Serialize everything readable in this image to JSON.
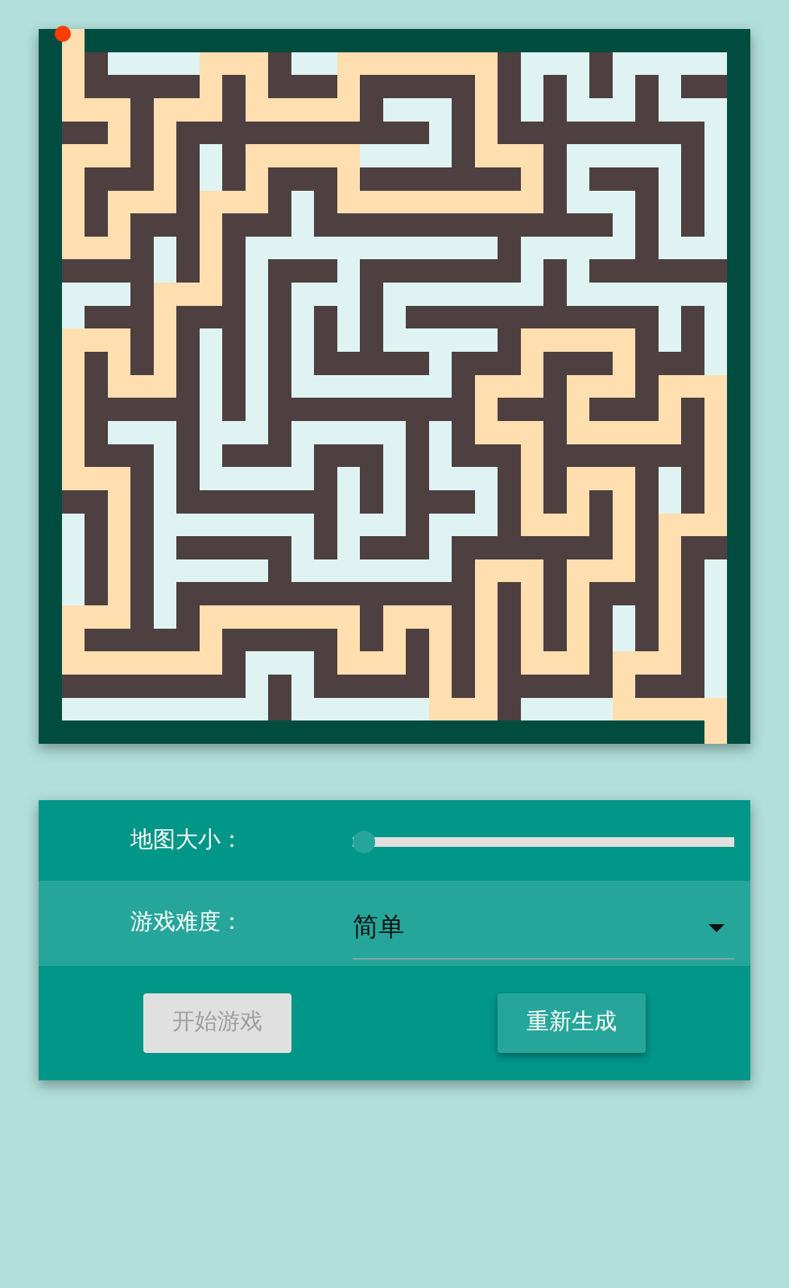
{
  "settings": {
    "rows": [
      {
        "kind": "slider",
        "label": "地图大小：",
        "level": 0.0
      },
      {
        "kind": "dropdown",
        "label": "游戏难度：",
        "value": "简单"
      }
    ]
  },
  "buttons": [
    {
      "label": "开始游戏",
      "disabled": true
    },
    {
      "label": "重新生成",
      "disabled": false
    }
  ]
}
